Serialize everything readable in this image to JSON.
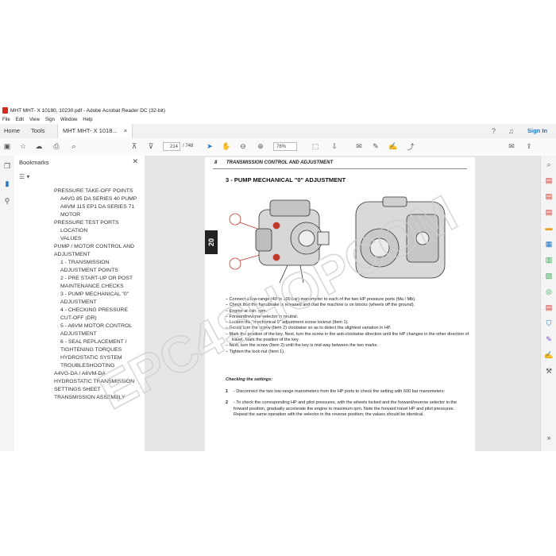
{
  "window": {
    "title": "MHT MHT- X 10180, 10230.pdf - Adobe Acrobat Reader DC (32-bit)",
    "menu": [
      "File",
      "Edit",
      "View",
      "Sign",
      "Window",
      "Help"
    ]
  },
  "tabs": {
    "home": "Home",
    "tools": "Tools",
    "doc": "MHT MHT- X 1018...",
    "close": "×",
    "signin": "Sign In"
  },
  "toolbar": {
    "page_current": "214",
    "page_total": "/ 748",
    "zoom": "76%"
  },
  "bookmarks": {
    "title": "Bookmarks",
    "items": [
      {
        "label": "PRESSURE TAKE-OFF POINTS",
        "level": 1
      },
      {
        "label": "A4VG 85 DA SERIES 40 PUMP",
        "level": 2
      },
      {
        "label": "A6VM 115 EP1 DA SERIES 71",
        "level": 2
      },
      {
        "label": "MOTOR",
        "level": 2
      },
      {
        "label": "PRESSURE TEST PORTS",
        "level": 1
      },
      {
        "label": "LOCATION",
        "level": 2
      },
      {
        "label": "VALUES",
        "level": 2
      },
      {
        "label": "PUMP / MOTOR CONTROL AND",
        "level": 1
      },
      {
        "label": "ADJUSTMENT",
        "level": 1
      },
      {
        "label": "1 - TRANSMISSION",
        "level": 2
      },
      {
        "label": "ADJUSTMENT POINTS",
        "level": 2
      },
      {
        "label": "2 - PRE START-UP OR POST",
        "level": 2
      },
      {
        "label": "MAINTENANCE CHECKS",
        "level": 2
      },
      {
        "label": "3 - PUMP MECHANICAL \"0\"",
        "level": 2
      },
      {
        "label": "ADJUSTMENT",
        "level": 2
      },
      {
        "label": "4 - CHECKING PRESSURE",
        "level": 2
      },
      {
        "label": "CUT-OFF (DR)",
        "level": 2
      },
      {
        "label": "5 - A6VM MOTOR CONTROL",
        "level": 2
      },
      {
        "label": "ADJUSTMENT",
        "level": 2
      },
      {
        "label": "6 - SEAL REPLACEMENT /",
        "level": 2
      },
      {
        "label": "TIGHTENING TORQUES",
        "level": 2
      },
      {
        "label": "HYDROSTATIC SYSTEM",
        "level": 2
      },
      {
        "label": "TROUBLESHOOTING",
        "level": 2
      },
      {
        "label": "A4VG-DA / A6VM-DA",
        "level": 1
      },
      {
        "label": "HYDROSTATIC TRANSMISSION",
        "level": 1
      },
      {
        "label": "SETTINGS SHEET",
        "level": 1
      },
      {
        "label": "TRANSMISSION ASSEMBLY",
        "level": 1
      }
    ]
  },
  "page": {
    "number": "8",
    "header": "TRANSMISSION CONTROL AND ADJUSTMENT",
    "side_tab": "20",
    "section_title": "3 - PUMP MECHANICAL \"0\" ADJUSTMENT",
    "bullets": [
      "–  Connect a low-range (40 to 100 bar) manometer to each of the two HP pressure ports (Ma / Mb).",
      "–  Check that the handbrake is released and that the machine is on blocks (wheels off the ground).",
      "–  Engine at min. rpm.",
      "–  Forward/reverse selector in neutral.",
      "–  Loosen the \"mechanical 0\" adjustment screw locknut (Item 1).",
      "–  Gently turn the screw (Item 2) clockwise so as to detect the slightest variation in HP.",
      "–  Mark the position of the key. Next, turn the screw in the anti-clockwise direction until the HP changes in the other direction of travel. Mark the position of the key.",
      "–  Next, turn the screw (Item 2) until the key is mid-way between the two marks.",
      "–  Tighten the lock-nut (Item 1)."
    ],
    "checking_title": "Checking the settings:",
    "steps": [
      {
        "n": "1",
        "text": "- Disconnect the two low-range manometers from the HP ports to check the setting with 600 bar manometers:"
      },
      {
        "n": "2",
        "text": "- To check the corresponding HP and pilot pressures, with the wheels locked and the forward/reverse selector in the forward position, gradually accelerate the engine to maximum rpm. Note the forward travel HP and pilot pressures. Repeat the same operation with the selector in the reverse position; the values should be identical."
      }
    ]
  },
  "watermark": "EPC4SHOPCOM",
  "icons": {
    "colors": {
      "red": "#d62a1e",
      "blue": "#1a73c7",
      "green": "#2aa64a",
      "purple": "#7b3fbf",
      "orange": "#e8a11a"
    }
  }
}
